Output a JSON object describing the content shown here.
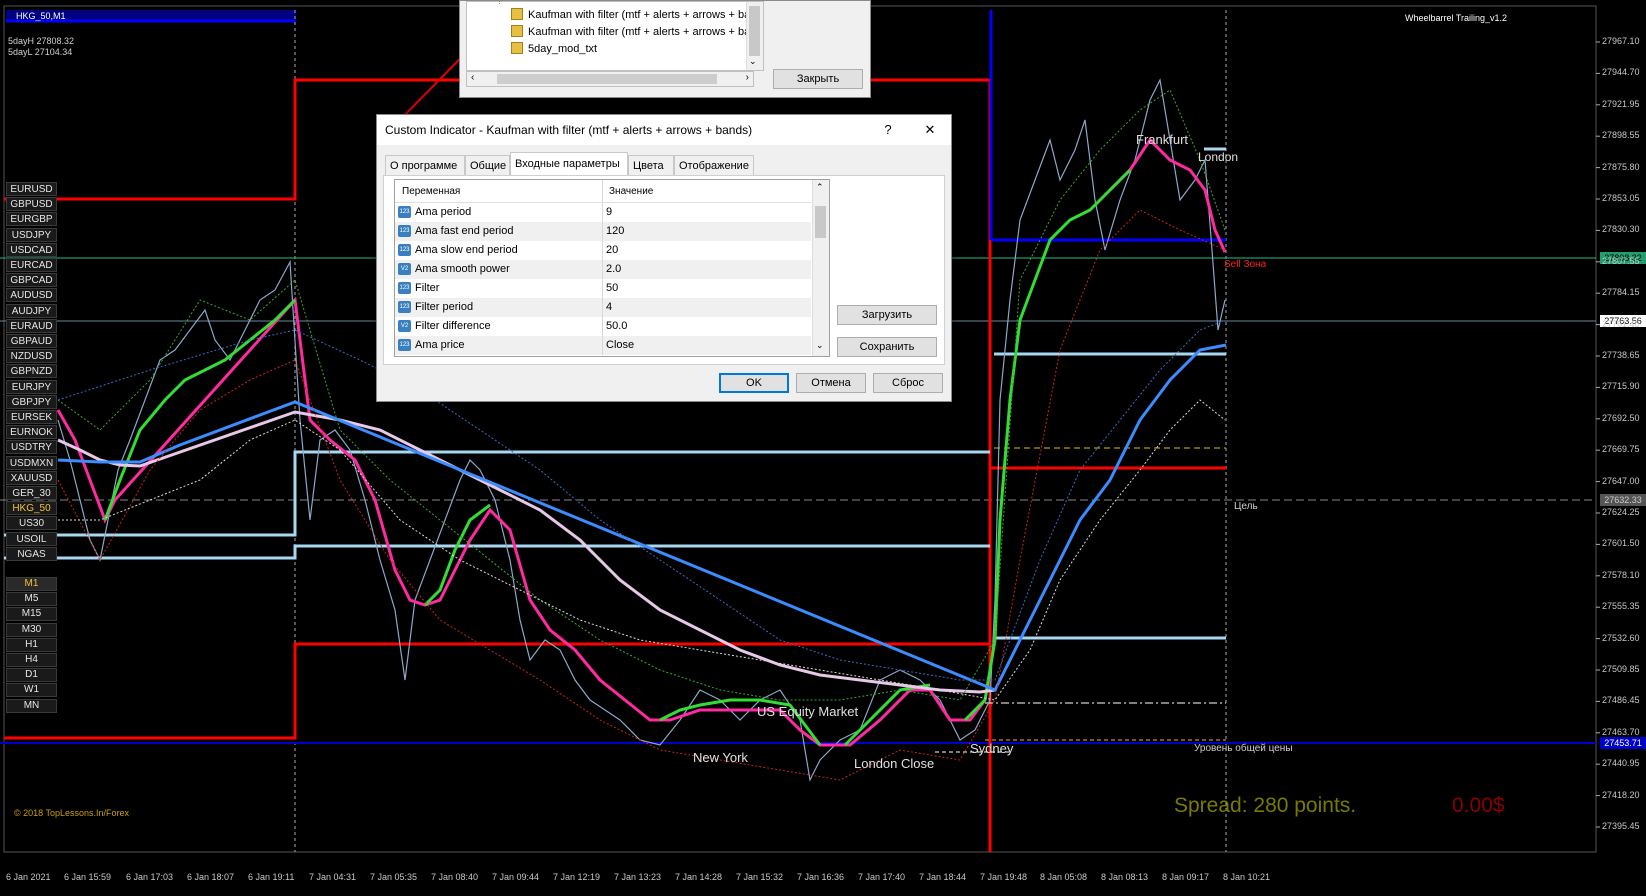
{
  "chart": {
    "symbol_title": "HKG_50,M1",
    "indicator_name": "Wheelbarrel Trailing_v1.2",
    "day_high": "5dayH 27808.32",
    "day_low": "5dayL 27104.34",
    "copyright": "© 2018 TopLessons.In/Forex",
    "spread_text": "Spread: 280 points.",
    "profit_text": "0.00$",
    "current_price_tag": "27808.32",
    "bid_price_tag": "27763.56",
    "target_price_tag": "27632.33",
    "bottom_price_tag": "27453.71",
    "sell_zone_label": "Sell Зона",
    "target_label": "Цель",
    "common_price_level_label": "Уровень общей цены",
    "colors": {
      "background": "#000000",
      "red_line": "#ff0000",
      "blue_line": "#0000ff",
      "green_ma": "#33dd33",
      "pink_ma": "#ff2aa0",
      "blue_ma": "#3a8cff",
      "white_ma": "#e8c8e8",
      "lightblue_level": "#a8d8f0",
      "spread_color": "#7a7a00",
      "profit_color": "#8b0000",
      "symbol_active": "#f2c230"
    }
  },
  "symbols": [
    "EURUSD",
    "GBPUSD",
    "EURGBP",
    "USDJPY",
    "USDCAD",
    "EURCAD",
    "GBPCAD",
    "AUDUSD",
    "AUDJPY",
    "EURAUD",
    "GBPAUD",
    "NZDUSD",
    "GBPNZD",
    "EURJPY",
    "GBPJPY",
    "EURSEK",
    "EURNOK",
    "USDTRY",
    "USDMXN",
    "XAUUSD",
    "GER_30",
    "HKG_50",
    "US30",
    "USOIL",
    "NGAS"
  ],
  "active_symbol": "HKG_50",
  "timeframes": [
    "M1",
    "M5",
    "M15",
    "M30",
    "H1",
    "H4",
    "D1",
    "W1",
    "MN"
  ],
  "active_timeframe": "M1",
  "price_axis": [
    "27967.10",
    "27944.70",
    "27921.95",
    "27898.55",
    "27875.80",
    "27853.05",
    "27830.30",
    "27807.55",
    "27784.15",
    "27761.40",
    "27738.65",
    "27715.90",
    "27692.50",
    "27669.75",
    "27647.00",
    "27624.25",
    "27601.50",
    "27578.10",
    "27555.35",
    "27532.60",
    "27509.85",
    "27486.45",
    "27463.70",
    "27440.95",
    "27418.20",
    "27395.45"
  ],
  "time_axis": [
    "6 Jan 2021",
    "6 Jan 15:59",
    "6 Jan 17:03",
    "6 Jan 18:07",
    "6 Jan 19:11",
    "7 Jan 04:31",
    "7 Jan 05:35",
    "7 Jan 08:40",
    "7 Jan 09:44",
    "7 Jan 12:19",
    "7 Jan 13:23",
    "7 Jan 14:28",
    "7 Jan 15:32",
    "7 Jan 16:36",
    "7 Jan 17:40",
    "7 Jan 18:44",
    "7 Jan 19:48",
    "8 Jan 05:08",
    "8 Jan 08:13",
    "8 Jan 09:17",
    "8 Jan 10:21"
  ],
  "sessions": {
    "new_york": "New York",
    "us_equity": "US Equity Market",
    "london_close": "London Close",
    "sydney": "Sydney",
    "frankfurt": "Frankfurt",
    "london": "London"
  },
  "navigator": {
    "items": [
      "Kaufman with filter (mtf + alerts + arrows + ban",
      "Kaufman with filter (mtf + alerts + arrows + ban",
      "5day_mod_txt"
    ],
    "close_button": "Закрыть"
  },
  "dialog": {
    "title": "Custom Indicator - Kaufman with filter (mtf +  alerts + arrows + bands)",
    "help_button": "?",
    "close_icon": "✕",
    "tabs": [
      "О программе",
      "Общие",
      "Входные параметры",
      "Цвета",
      "Отображение"
    ],
    "active_tab": "Входные параметры",
    "grid_header": {
      "variable": "Переменная",
      "value": "Значение"
    },
    "params": [
      {
        "name": "Ama period",
        "value": "9",
        "icon": "123"
      },
      {
        "name": "Ama fast end period",
        "value": "120",
        "icon": "123"
      },
      {
        "name": "Ama slow end period",
        "value": "20",
        "icon": "123"
      },
      {
        "name": "Ama smooth power",
        "value": "2.0",
        "icon": "V2"
      },
      {
        "name": "Filter",
        "value": "50",
        "icon": "123"
      },
      {
        "name": "Filter period",
        "value": "4",
        "icon": "123"
      },
      {
        "name": "Filter difference",
        "value": "50.0",
        "icon": "V2"
      },
      {
        "name": "Ama price",
        "value": "Close",
        "icon": "123"
      }
    ],
    "load_button": "Загрузить",
    "save_button": "Сохранить",
    "ok_button": "OK",
    "cancel_button": "Отмена",
    "reset_button": "Сброс"
  }
}
